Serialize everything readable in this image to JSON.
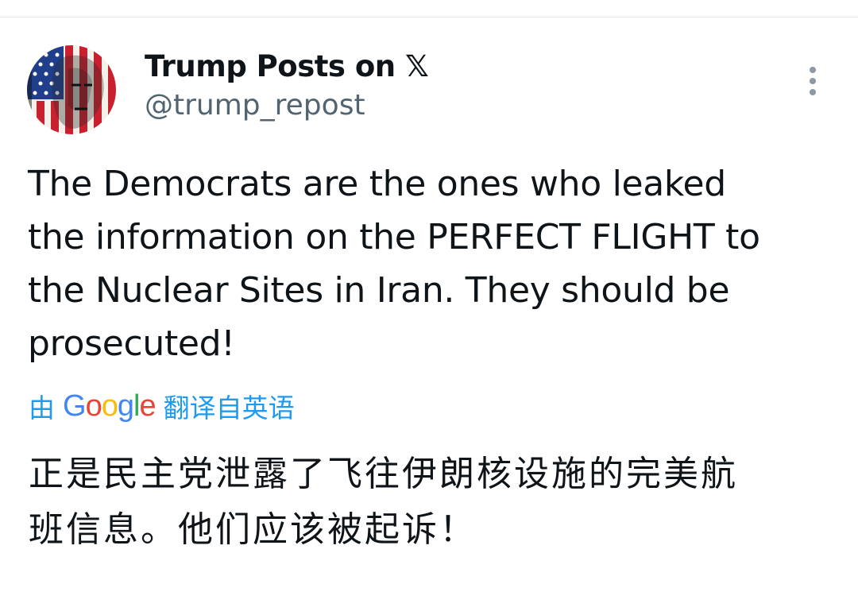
{
  "post": {
    "author": {
      "display_name": "Trump Posts on 𝕏",
      "handle": "@trump_repost",
      "avatar_icon": "american-flag-portrait-avatar"
    },
    "menu_icon": "more-vertical-icon",
    "text": "The Democrats are the ones who leaked\nthe information on the PERFECT FLIGHT to\nthe Nuclear Sites in Iran. They should be\nprosecuted!",
    "translation": {
      "prefix": "由",
      "provider": "Google",
      "suffix": "翻译自英语",
      "text": "正是民主党泄露了飞往伊朗核设施的完美航\n班信息。他们应该被起诉！"
    }
  },
  "colors": {
    "text": "#0f1419",
    "secondary": "#536471",
    "link": "#1d9bf0",
    "google_blue": "#4285f4",
    "google_red": "#ea4335",
    "google_yellow": "#fbbc05",
    "google_green": "#34a853"
  }
}
